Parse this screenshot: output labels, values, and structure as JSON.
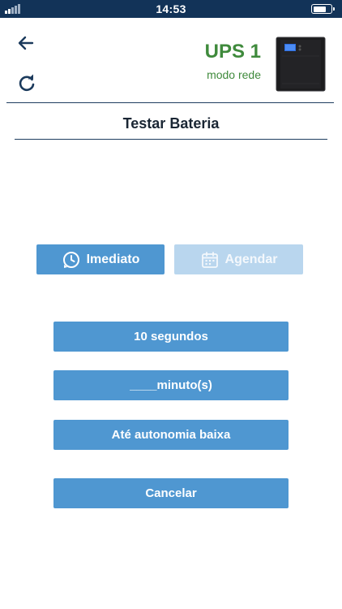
{
  "status_bar": {
    "time": "14:53"
  },
  "header": {
    "title": "UPS 1",
    "status": "modo rede"
  },
  "section": {
    "title": "Testar Bateria"
  },
  "modes": {
    "immediate_label": "Imediato",
    "schedule_label": "Agendar"
  },
  "actions": {
    "ten_seconds": "10 segundos",
    "minutes": "____minuto(s)",
    "low_autonomy": "Até autonomia baixa",
    "cancel": "Cancelar"
  },
  "colors": {
    "status_bar": "#123358",
    "brand_green": "#3f8a3c",
    "button_blue": "#4f97d1",
    "button_disabled": "#b9d6ee",
    "divider": "#1f3d5f"
  }
}
